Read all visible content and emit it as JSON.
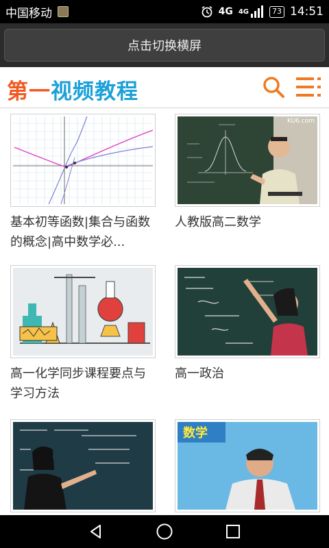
{
  "status_bar": {
    "carrier": "中国移动",
    "network": "4G",
    "network2": "4G",
    "battery": "73",
    "time": "14:51"
  },
  "rotate_button": {
    "label": "点击切换横屏"
  },
  "app_bar": {
    "logo_part1": "第一",
    "logo_part2": "视频教程",
    "search_icon": "search-icon",
    "menu_icon": "list-menu-icon"
  },
  "videos": [
    {
      "title": "基本初等函数|集合与函数的概念|高中数学必..."
    },
    {
      "title": "人教版高二数学"
    },
    {
      "title": "高一化学同步课程要点与学习方法"
    },
    {
      "title": "高一政治"
    },
    {
      "title": ""
    },
    {
      "title": ""
    }
  ],
  "thumb2_watermark": "KU6.com",
  "thumb6_badge": "数学",
  "nav_bar": {
    "back": "back-icon",
    "home": "home-icon",
    "recents": "recents-icon"
  },
  "colors": {
    "logo_orange": "#f05a22",
    "logo_blue": "#1ba0d8",
    "accent": "#f07a22"
  }
}
